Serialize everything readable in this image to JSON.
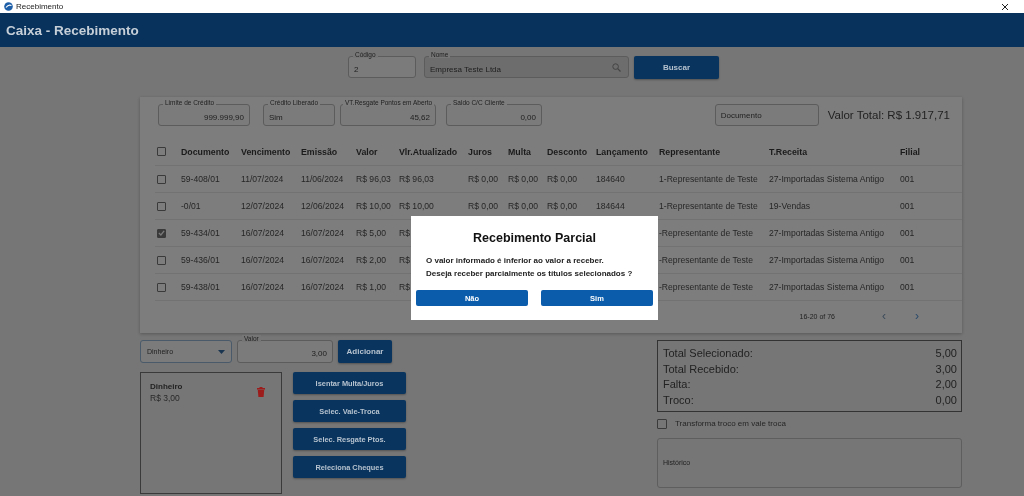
{
  "window": {
    "title": "Recebimento"
  },
  "header": {
    "title": "Caixa - Recebimento"
  },
  "search": {
    "fields": [
      {
        "label": "Código",
        "value": "2",
        "disabled": false
      },
      {
        "label": "Nome",
        "value": "Empresa Teste Ltda",
        "disabled": true
      }
    ],
    "button": "Buscar"
  },
  "client_info": [
    {
      "label": "Limite de Crédito",
      "value": "999.999,90",
      "kind": "number"
    },
    {
      "label": "Crédito Liberado",
      "value": "Sim",
      "kind": "text"
    },
    {
      "label": "VT.Resgate Pontos em Aberto",
      "value": "45,62",
      "kind": "number"
    },
    {
      "label": "Saldo C/C Cliente",
      "value": "0,00",
      "kind": "number"
    }
  ],
  "document_filter": {
    "placeholder": "Documento"
  },
  "total_value": "Valor Total: R$ 1.917,71",
  "table": {
    "select_all_checked": false,
    "columns": [
      "Documento",
      "Vencimento",
      "Emissão",
      "Valor",
      "Vlr.Atualizado",
      "Juros",
      "Multa",
      "Desconto",
      "Lançamento",
      "Representante",
      "T.Receita",
      "Filial"
    ],
    "rows": [
      {
        "checked": false,
        "cells": [
          "59-408/01",
          "11/07/2024",
          "11/06/2024",
          "R$ 96,03",
          "R$ 96,03",
          "R$ 0,00",
          "R$ 0,00",
          "R$ 0,00",
          "184640",
          "1-Representante de Teste",
          "27-Importadas Sistema Antigo",
          "001"
        ]
      },
      {
        "checked": false,
        "cells": [
          "-0/01",
          "12/07/2024",
          "12/06/2024",
          "R$ 10,00",
          "R$ 10,00",
          "R$ 0,00",
          "R$ 0,00",
          "R$ 0,00",
          "184644",
          "1-Representante de Teste",
          "19-Vendas",
          "001"
        ]
      },
      {
        "checked": true,
        "cells": [
          "59-434/01",
          "16/07/2024",
          "16/07/2024",
          "R$ 5,00",
          "R$",
          "",
          "",
          "",
          "",
          "-Representante de Teste",
          "27-Importadas Sistema Antigo",
          "001"
        ]
      },
      {
        "checked": false,
        "cells": [
          "59-436/01",
          "16/07/2024",
          "16/07/2024",
          "R$ 2,00",
          "R$",
          "",
          "",
          "",
          "",
          "-Representante de Teste",
          "27-Importadas Sistema Antigo",
          "001"
        ]
      },
      {
        "checked": false,
        "cells": [
          "59-438/01",
          "16/07/2024",
          "16/07/2024",
          "R$ 1,00",
          "R$",
          "",
          "",
          "",
          "",
          "-Representante de Teste",
          "27-Importadas Sistema Antigo",
          "001"
        ]
      }
    ],
    "pagination": {
      "range": "16-20 of 76",
      "prev": "‹",
      "next": "›"
    }
  },
  "payment": {
    "method": "Dinheiro",
    "amount_label": "Valor",
    "amount": "3,00",
    "add_button": "Adicionar"
  },
  "payments": [
    {
      "method": "Dinheiro",
      "amount": "R$ 3,00"
    }
  ],
  "actions": [
    "Isentar Multa/Juros",
    "Selec. Vale-Troca",
    "Selec. Resgate Ptos.",
    "Releciona Cheques"
  ],
  "totals": [
    {
      "label": "Total Selecionado:",
      "value": "5,00"
    },
    {
      "label": "Total Recebido:",
      "value": "3,00"
    },
    {
      "label": "Falta:",
      "value": "2,00"
    },
    {
      "label": "Troco:",
      "value": "0,00"
    }
  ],
  "change_to_voucher": {
    "label": "Transforma troco em vale troca",
    "checked": false
  },
  "history": {
    "placeholder": "Histórico"
  },
  "dialog": {
    "title": "Recebimento Parcial",
    "message": [
      "O valor informado é inferior ao valor a receber.",
      "Deseja receber parcialmente os títulos selecionados ?"
    ],
    "buttons": [
      "Não",
      "Sim"
    ]
  }
}
